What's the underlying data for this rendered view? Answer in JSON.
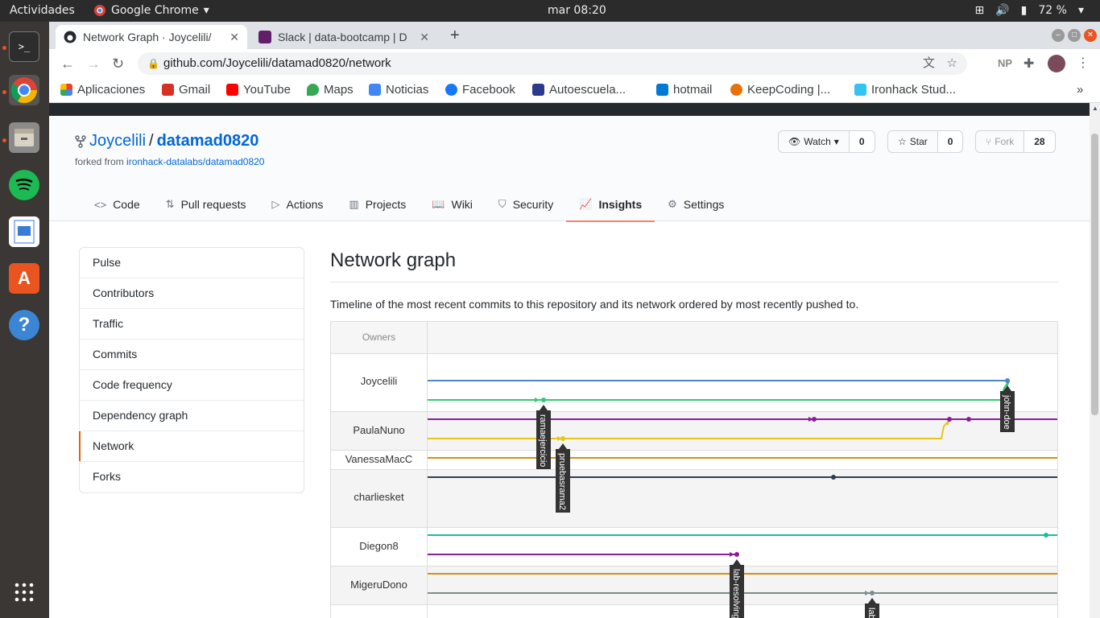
{
  "os": {
    "activities": "Actividades",
    "app_name": "Google Chrome",
    "clock": "mar 08:20",
    "battery": "72 %"
  },
  "browser": {
    "tabs": [
      {
        "title": "Network Graph · Joycelili/",
        "active": true
      },
      {
        "title": "Slack | data-bootcamp | D",
        "active": false
      }
    ],
    "url": "github.com/Joycelili/datamad0820/network",
    "profile_initials": "NP",
    "bookmarks": [
      {
        "label": "Aplicaciones",
        "color": "#4285f4"
      },
      {
        "label": "Gmail",
        "color": "#d93025"
      },
      {
        "label": "YouTube",
        "color": "#ff0000"
      },
      {
        "label": "Maps",
        "color": "#34a853"
      },
      {
        "label": "Noticias",
        "color": "#4285f4"
      },
      {
        "label": "Facebook",
        "color": "#1877f2"
      },
      {
        "label": "Autoescuela...",
        "color": "#2b3a8c"
      },
      {
        "label": "hotmail",
        "color": "#0078d4"
      },
      {
        "label": "KeepCoding |...",
        "color": "#e8710a"
      },
      {
        "label": "Ironhack Stud...",
        "color": "#32c3f0"
      }
    ]
  },
  "repo": {
    "owner": "Joycelili",
    "separator": "/",
    "name": "datamad0820",
    "forked_prefix": "forked from",
    "forked_from": "ironhack-datalabs/datamad0820",
    "watch_label": "Watch",
    "watch_count": "0",
    "star_label": "Star",
    "star_count": "0",
    "fork_label": "Fork",
    "fork_count": "28",
    "nav": [
      {
        "label": "Code",
        "icon": "code-icon"
      },
      {
        "label": "Pull requests",
        "icon": "pull-request-icon"
      },
      {
        "label": "Actions",
        "icon": "play-icon"
      },
      {
        "label": "Projects",
        "icon": "project-icon"
      },
      {
        "label": "Wiki",
        "icon": "book-icon"
      },
      {
        "label": "Security",
        "icon": "shield-icon"
      },
      {
        "label": "Insights",
        "icon": "graph-icon",
        "selected": true
      },
      {
        "label": "Settings",
        "icon": "gear-icon"
      }
    ]
  },
  "sidebar": {
    "items": [
      {
        "label": "Pulse"
      },
      {
        "label": "Contributors"
      },
      {
        "label": "Traffic"
      },
      {
        "label": "Commits"
      },
      {
        "label": "Code frequency"
      },
      {
        "label": "Dependency graph"
      },
      {
        "label": "Network",
        "selected": true
      },
      {
        "label": "Forks"
      }
    ]
  },
  "main": {
    "title": "Network graph",
    "description": "Timeline of the most recent commits to this repository and its network ordered by most recently pushed to.",
    "owners_header": "Owners",
    "owners": [
      "Joycelili",
      "PaulaNuno",
      "VanessaMacC",
      "charliesket",
      "Diegon8",
      "MigeruDono"
    ],
    "branch_labels": [
      "ramaejercicio",
      "pruebasrama2",
      "john-doe",
      "lab-resolving",
      "lab"
    ],
    "colors": {
      "blue": "#4a86c8",
      "green": "#2ecc71",
      "purple": "#8e1b9e",
      "yellow": "#e6c619",
      "orange": "#d4910e",
      "navy": "#2c3e50",
      "teal": "#1abc9c",
      "gray": "#7f8c8d"
    }
  }
}
